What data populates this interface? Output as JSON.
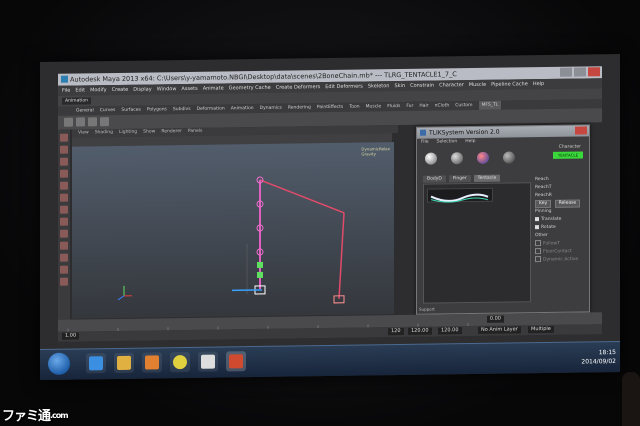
{
  "window": {
    "title": "Autodesk Maya 2013 x64: C:\\Users\\y-yamamoto.NBGI\\Desktop\\data\\scenes\\2BoneChain.mb* --- TLRG_TENTACLE1_7_C"
  },
  "menus": [
    "File",
    "Edit",
    "Modify",
    "Create",
    "Display",
    "Window",
    "Assets",
    "Animate",
    "Geometry Cache",
    "Create Deformers",
    "Edit Deformers",
    "Skeleton",
    "Skin",
    "Constrain",
    "Character",
    "Muscle",
    "Pipeline Cache",
    "Help"
  ],
  "mode": "Animation",
  "shelf_tabs": [
    "General",
    "Curves",
    "Surfaces",
    "Polygons",
    "Subdivs",
    "Deformation",
    "Animation",
    "Dynamics",
    "Rendering",
    "PaintEffects",
    "Toon",
    "Muscle",
    "Fluids",
    "Fur",
    "Hair",
    "nCloth",
    "Custom",
    "MFS_TL"
  ],
  "viewport": {
    "menus": [
      "View",
      "Shading",
      "Lighting",
      "Show",
      "Renderer",
      "Panels"
    ],
    "hud": [
      "DynamicRelax",
      "Gravity"
    ]
  },
  "time": {
    "ticks": [
      "1.00",
      "120",
      "120.00",
      "120.00",
      "0.00"
    ],
    "anim_layer": "No Anim Layer",
    "character_set": "Multiple"
  },
  "tlik": {
    "title": "TLIKSystem Version 2.0",
    "menus": [
      "File",
      "Selection",
      "Help"
    ],
    "tabs": [
      "BodyD",
      "Finger",
      "Tentacle"
    ],
    "character_label": "Character",
    "character_value": "TENTACLE",
    "reach_label": "Reach",
    "reach_t": "ReachT",
    "reach_r": "ReachR",
    "key_button": "Key",
    "release_button": "Release",
    "pinning_label": "Pinning",
    "translate": "Translate",
    "rotate": "Rotate",
    "other_label": "Other",
    "followT": "FollowT",
    "floor_contact": "FloorContact",
    "dynamic_active": "Dynamic Active",
    "support": "Support"
  },
  "taskbar": {
    "time": "18:15",
    "date": "2014/09/02"
  },
  "watermark": {
    "text": "ファミ通",
    "suffix": ".com"
  },
  "colors": {
    "accent_green": "#3ad83a",
    "joint_pink": "#e0609a",
    "chain_red": "#e04b6a"
  }
}
